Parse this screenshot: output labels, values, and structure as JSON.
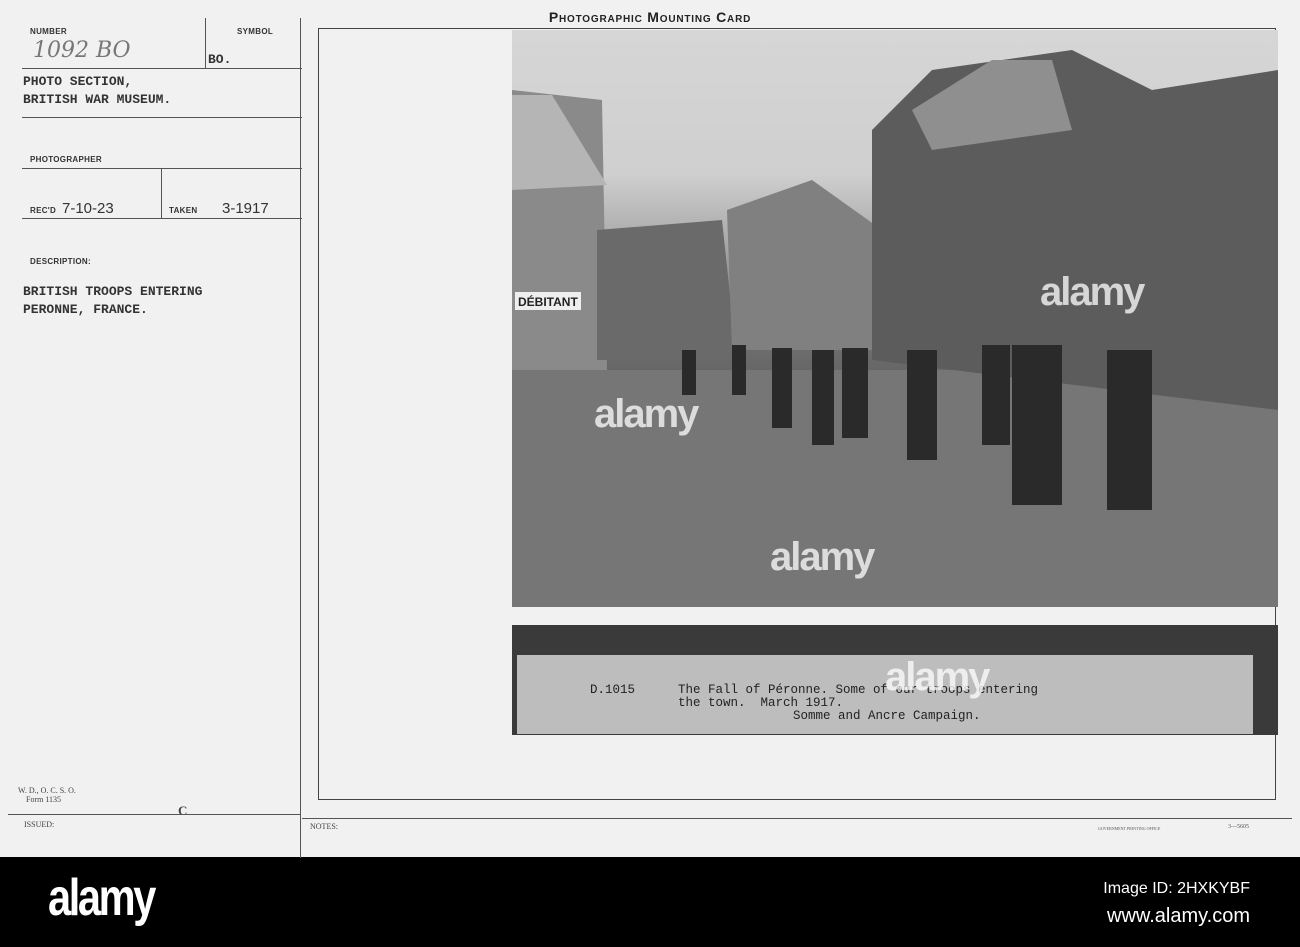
{
  "card": {
    "title": "Photographic Mounting Card",
    "number_label": "NUMBER",
    "number_value": "1092  BO",
    "symbol_label": "SYMBOL",
    "symbol_value": "BO.",
    "source_line1": "PHOTO SECTION,",
    "source_line2": "BRITISH WAR MUSEUM.",
    "photographer_label": "PHOTOGRAPHER",
    "recd_label": "REC'D",
    "recd_value": "7-10-23",
    "taken_label": "TAKEN",
    "taken_value": "3-1917",
    "description_label": "DESCRIPTION:",
    "description_line1": "BRITISH TROOPS ENTERING",
    "description_line2": "PERONNE, FRANCE.",
    "form_line1": "W. D., O. C. S. O.",
    "form_line2": "Form 1135",
    "mark": "C",
    "issued_label": "ISSUED:",
    "notes_label": "NOTES:",
    "printer": "GOVERNMENT PRINTING OFFICE",
    "printer_code": "3—5605"
  },
  "photo": {
    "shop_sign": "DÉBITANT",
    "caption_id": "D.1015",
    "caption_line1": "The Fall of Péronne. Some of our troops entering",
    "caption_line2": "the town.  March 1917.",
    "caption_line3": "Somme and Ancre Campaign."
  },
  "watermark": {
    "text": "alamy",
    "image_id": "Image ID: 2HXKYBF",
    "url": "www.alamy.com"
  }
}
